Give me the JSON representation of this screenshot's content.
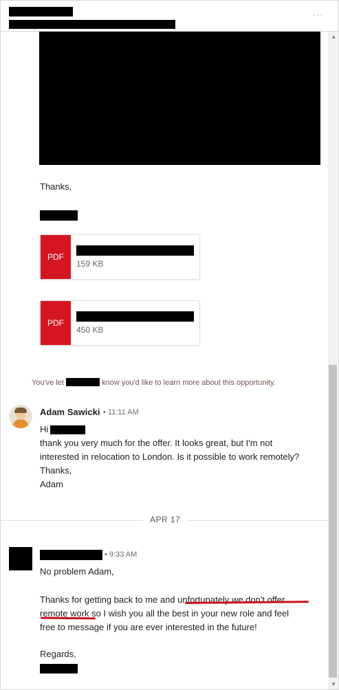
{
  "header": {
    "more_icon": "more-horizontal-icon",
    "more_text": "···"
  },
  "message1": {
    "closing": "Thanks,",
    "attachments": [
      {
        "type_label": "PDF",
        "size": "159 KB"
      },
      {
        "type_label": "PDF",
        "size": "450 KB"
      }
    ]
  },
  "notice": {
    "prefix": "You've let",
    "suffix": "know you'd like to learn more about this opportunity."
  },
  "message2": {
    "sender": "Adam Sawicki",
    "time": "• 11:11 AM",
    "lines": [
      "Hi",
      "thank you very much for the offer. It looks great, but I'm not",
      "interested in relocation to London. Is it possible to work remotely?",
      "Thanks,",
      "Adam"
    ]
  },
  "date_divider": "APR 17",
  "message3": {
    "time": "• 9:33 AM",
    "greeting": "No problem Adam,",
    "body_lines": [
      "Thanks for getting back to me and unfortunately we don't offer",
      "remote work so I wish you all the best in your new role and feel",
      "free to message if you are ever interested in the future!"
    ],
    "closing": "Regards,"
  },
  "colors": {
    "pdf_red": "#d51622",
    "annotation_red": "#c8101f"
  }
}
